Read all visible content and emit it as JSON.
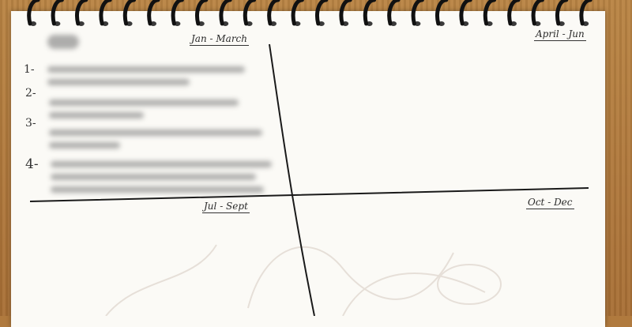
{
  "quadrants": {
    "top_left": "Jan - March",
    "top_right": "April - Jun",
    "bottom_left": "Jul - Sept",
    "bottom_right": "Oct - Dec"
  },
  "list_numbers": [
    "1-",
    "2-",
    "3-",
    "4-"
  ],
  "colors": {
    "paper": "#fbfaf6",
    "ink": "#1a1a1a",
    "wood": "#b07a3e",
    "spiral": "#111111"
  }
}
